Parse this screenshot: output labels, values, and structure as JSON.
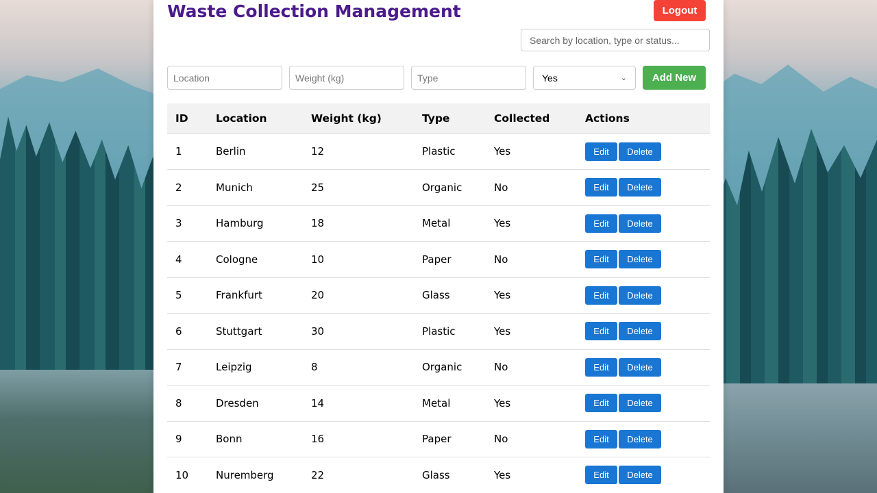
{
  "header": {
    "title": "Waste Collection Management",
    "logout_label": "Logout",
    "search_placeholder": "Search by location, type or status..."
  },
  "form": {
    "location_placeholder": "Location",
    "weight_placeholder": "Weight (kg)",
    "type_placeholder": "Type",
    "collected_selected": "Yes",
    "add_label": "Add New"
  },
  "table": {
    "headers": [
      "ID",
      "Location",
      "Weight (kg)",
      "Type",
      "Collected",
      "Actions"
    ],
    "edit_label": "Edit",
    "delete_label": "Delete",
    "rows": [
      [
        "1",
        "Berlin",
        "12",
        "Plastic",
        "Yes"
      ],
      [
        "2",
        "Munich",
        "25",
        "Organic",
        "No"
      ],
      [
        "3",
        "Hamburg",
        "18",
        "Metal",
        "Yes"
      ],
      [
        "4",
        "Cologne",
        "10",
        "Paper",
        "No"
      ],
      [
        "5",
        "Frankfurt",
        "20",
        "Glass",
        "Yes"
      ],
      [
        "6",
        "Stuttgart",
        "30",
        "Plastic",
        "Yes"
      ],
      [
        "7",
        "Leipzig",
        "8",
        "Organic",
        "No"
      ],
      [
        "8",
        "Dresden",
        "14",
        "Metal",
        "Yes"
      ],
      [
        "9",
        "Bonn",
        "16",
        "Paper",
        "No"
      ],
      [
        "10",
        "Nuremberg",
        "22",
        "Glass",
        "Yes"
      ]
    ]
  },
  "colors": {
    "title": "#4b1a8c",
    "logout": "#f44336",
    "add": "#4caf50",
    "action": "#1976d2"
  }
}
